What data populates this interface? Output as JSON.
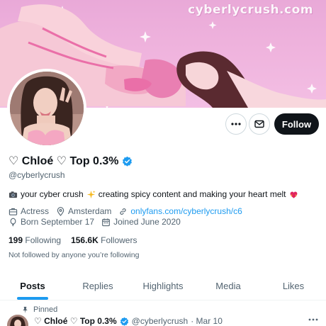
{
  "banner": {
    "watermark": "cyberlycrush.com"
  },
  "actions": {
    "follow_label": "Follow"
  },
  "profile": {
    "display_name": "♡ Chloé ♡ Top 0.3%",
    "handle": "@cyberlycrush",
    "bio_part1": "your cyber crush",
    "bio_part2": "creating spicy content and making your heart melt",
    "profession": "Actress",
    "location": "Amsterdam",
    "link": "onlyfans.com/cyberlycrush/c6",
    "birthday": "Born September 17",
    "joined": "Joined June 2020",
    "following_count": "199",
    "following_label": "Following",
    "followers_count": "156.6K",
    "followers_label": "Followers",
    "not_followed_text": "Not followed by anyone you’re following"
  },
  "tabs": [
    {
      "label": "Posts"
    },
    {
      "label": "Replies"
    },
    {
      "label": "Highlights"
    },
    {
      "label": "Media"
    },
    {
      "label": "Likes"
    }
  ],
  "pinned_tweet": {
    "pinned_label": "Pinned",
    "name": "♡ Chloé ♡ Top 0.3%",
    "handle": "@cyberlycrush",
    "date": "· Mar 10"
  },
  "colors": {
    "accent": "#1d9bf0",
    "text": "#0f1419",
    "muted": "#536471",
    "banner_pink": "#efb3dd"
  }
}
